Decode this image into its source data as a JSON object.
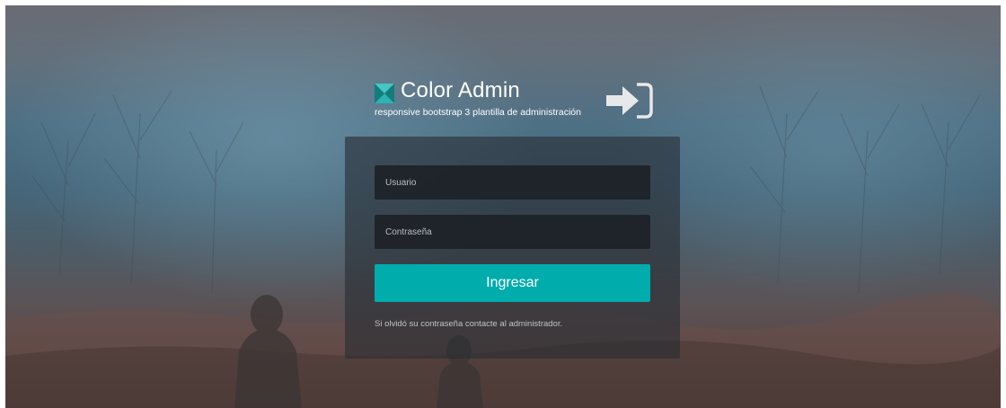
{
  "brand": {
    "title": "Color Admin",
    "subtitle": "responsive bootstrap 3 plantilla de administración",
    "logo_icon": "color-admin-logo-icon",
    "accent_colors": [
      "#2bb3b1",
      "#0f7f7e",
      "#45c6c4",
      "#177a7a"
    ]
  },
  "header": {
    "signin_icon": "sign-in-icon"
  },
  "login": {
    "username_placeholder": "Usuario",
    "password_placeholder": "Contraseña",
    "submit_label": "Ingresar",
    "help_text": "Si olvidó su contraseña contacte al administrador."
  },
  "colors": {
    "button": "#00acac",
    "panel": "#282d34",
    "field": "#1c2026"
  }
}
